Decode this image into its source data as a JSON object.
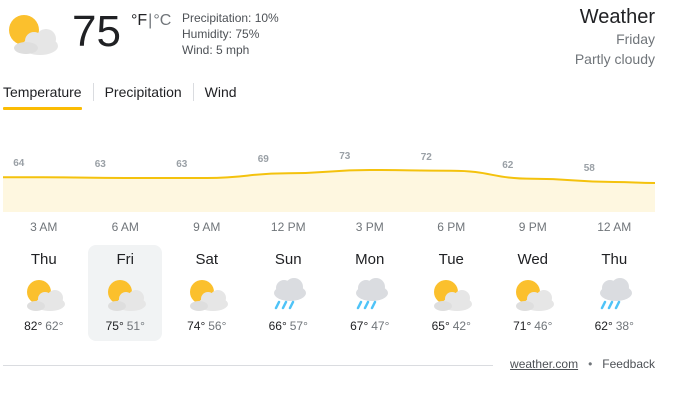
{
  "current": {
    "temp": "75",
    "unit_f": "°F",
    "unit_sep": "|",
    "unit_c": "°C",
    "precipitation": "Precipitation: 10%",
    "humidity": "Humidity: 75%",
    "wind": "Wind: 5 mph",
    "icon": "partly-cloudy-icon"
  },
  "header": {
    "title": "Weather",
    "day": "Friday",
    "condition": "Partly cloudy"
  },
  "tabs": [
    {
      "label": "Temperature",
      "active": true
    },
    {
      "label": "Precipitation",
      "active": false
    },
    {
      "label": "Wind",
      "active": false
    }
  ],
  "colors": {
    "accent": "#fbbc04",
    "area_fill": "#fef7e0",
    "line": "#f4c20d"
  },
  "chart_data": {
    "type": "area",
    "x": [
      "3 AM",
      "6 AM",
      "9 AM",
      "12 PM",
      "3 PM",
      "6 PM",
      "9 PM",
      "12 AM"
    ],
    "values": [
      64,
      63,
      63,
      69,
      73,
      72,
      62,
      58
    ],
    "data_labels": [
      "64",
      "63",
      "63",
      "69",
      "73",
      "72",
      "62",
      "58"
    ],
    "title": "",
    "xlabel": "",
    "ylabel": ""
  },
  "forecast": [
    {
      "day": "Thu",
      "high": "82°",
      "low": "62°",
      "icon": "partly-cloudy-icon",
      "selected": false
    },
    {
      "day": "Fri",
      "high": "75°",
      "low": "51°",
      "icon": "partly-cloudy-icon",
      "selected": true
    },
    {
      "day": "Sat",
      "high": "74°",
      "low": "56°",
      "icon": "partly-cloudy-icon",
      "selected": false
    },
    {
      "day": "Sun",
      "high": "66°",
      "low": "57°",
      "icon": "rain-icon",
      "selected": false
    },
    {
      "day": "Mon",
      "high": "67°",
      "low": "47°",
      "icon": "rain-icon",
      "selected": false
    },
    {
      "day": "Tue",
      "high": "65°",
      "low": "42°",
      "icon": "partly-cloudy-icon",
      "selected": false
    },
    {
      "day": "Wed",
      "high": "71°",
      "low": "46°",
      "icon": "partly-cloudy-icon",
      "selected": false
    },
    {
      "day": "Thu",
      "high": "62°",
      "low": "38°",
      "icon": "rain-icon",
      "selected": false
    }
  ],
  "footer": {
    "source": "weather.com",
    "dot": "•",
    "feedback": "Feedback"
  }
}
